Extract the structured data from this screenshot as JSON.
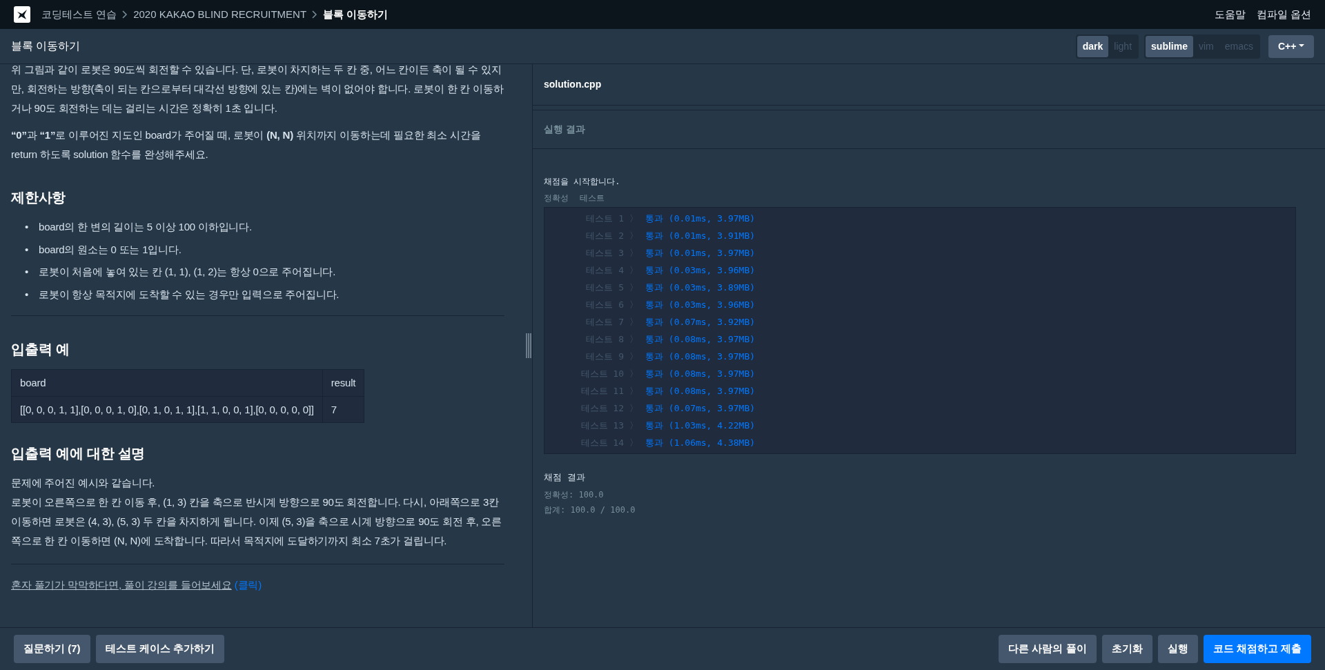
{
  "breadcrumb": [
    {
      "label": "코딩테스트 연습",
      "current": false
    },
    {
      "label": "2020 KAKAO BLIND RECRUITMENT",
      "current": false
    },
    {
      "label": "블록 이동하기",
      "current": true
    }
  ],
  "nav_links": [
    "도움말",
    "컴파일 옵션"
  ],
  "problem_title": "블록 이동하기",
  "theme_toggle": [
    {
      "label": "dark",
      "selected": true
    },
    {
      "label": "light",
      "selected": false
    }
  ],
  "keymap_toggle": [
    {
      "label": "sublime",
      "selected": true
    },
    {
      "label": "vim",
      "selected": false
    },
    {
      "label": "emacs",
      "selected": false
    }
  ],
  "language": "C++",
  "description": [
    "위 그림과 같이 로봇은 90도씩 회전할 수 있습니다. 단, 로봇이 차지하는 두 칸 중, 어느 칸이든 축이 될 수 있지만, 회전하는 방향(축이 되는 칸으로부터 대각선 방향에 있는 칸)에는 벽이 없어야 합니다. 로봇이 한 칸 이동하거나 90도 회전하는 데는 걸리는 시간은 정확히 1초 입니다.",
    "**“0”**과 **“1”**로 이루어진 지도인 board가 주어질 때, 로봇이 **(N, N)** 위치까지 이동하는데 필요한 최소 시간을 return 하도록 solution 함수를 완성해주세요."
  ],
  "constraints": {
    "title": "제한사항",
    "items": [
      {
        "marker": "•",
        "text": "board의 한 변의 길이는 5 이상 100 이하입니다."
      },
      {
        "marker": "•",
        "text": "board의 원소는 0 또는 1입니다."
      },
      {
        "marker": "•",
        "text": "로봇이 처음에 놓여 있는 칸 (1, 1), (1, 2)는 항상 0으로 주어집니다."
      },
      {
        "marker": "•",
        "text": "로봇이 항상 목적지에 도착할 수 있는 경우만 입력으로 주어집니다."
      }
    ]
  },
  "examples": {
    "title": "입출력 예",
    "columns": [
      "board",
      "result"
    ],
    "rows": [
      [
        "[[0, 0, 0, 1, 1],[0, 0, 0, 1, 0],[0, 1, 0, 1, 1],[1, 1, 0, 0, 1],[0, 0, 0, 0, 0]]",
        "7"
      ]
    ]
  },
  "explanation": {
    "title": "입출력 예에 대한 설명",
    "lines": [
      "문제에 주어진 예시와 같습니다.",
      "로봇이 오른쪽으로 한 칸 이동 후, (1, 3) 칸을 축으로 반시계 방향으로 90도 회전합니다. 다시, 아래쪽으로 3칸 이동하면 로봇은 (4, 3), (5, 3) 두 칸을 차지하게 됩니다. 이제 (5, 3)을 축으로 시계 방향으로 90도 회전 후, 오른쪽으로 한 칸 이동하면 (N, N)에 도착합니다. 따라서 목적지에 도달하기까지 최소 7초가 걸립니다."
    ]
  },
  "help_link": {
    "text": "혼자 풀기가 막막하다면, 풀이 강의를 들어보세요",
    "link": "(클릭)"
  },
  "editor_tab": "solution.cpp",
  "result_title": "실행 결과",
  "grading": {
    "start": "채점을 시작합니다.",
    "labels": [
      "정확성",
      "테스트"
    ],
    "tests": [
      {
        "label": "테스트 1",
        "arrow": "〉",
        "passed": true,
        "result": "통과 (0.01ms, 3.97MB)"
      },
      {
        "label": "테스트 2",
        "arrow": "〉",
        "passed": true,
        "result": "통과 (0.01ms, 3.91MB)"
      },
      {
        "label": "테스트 3",
        "arrow": "〉",
        "passed": true,
        "result": "통과 (0.01ms, 3.97MB)"
      },
      {
        "label": "테스트 4",
        "arrow": "〉",
        "passed": true,
        "result": "통과 (0.03ms, 3.96MB)"
      },
      {
        "label": "테스트 5",
        "arrow": "〉",
        "passed": true,
        "result": "통과 (0.03ms, 3.89MB)"
      },
      {
        "label": "테스트 6",
        "arrow": "〉",
        "passed": true,
        "result": "통과 (0.03ms, 3.96MB)"
      },
      {
        "label": "테스트 7",
        "arrow": "〉",
        "passed": true,
        "result": "통과 (0.07ms, 3.92MB)"
      },
      {
        "label": "테스트 8",
        "arrow": "〉",
        "passed": true,
        "result": "통과 (0.08ms, 3.97MB)"
      },
      {
        "label": "테스트 9",
        "arrow": "〉",
        "passed": true,
        "result": "통과 (0.08ms, 3.97MB)"
      },
      {
        "label": "테스트 10",
        "arrow": "〉",
        "passed": true,
        "result": "통과 (0.08ms, 3.97MB)"
      },
      {
        "label": "테스트 11",
        "arrow": "〉",
        "passed": true,
        "result": "통과 (0.08ms, 3.97MB)"
      },
      {
        "label": "테스트 12",
        "arrow": "〉",
        "passed": true,
        "result": "통과 (0.07ms, 3.97MB)"
      },
      {
        "label": "테스트 13",
        "arrow": "〉",
        "passed": true,
        "result": "통과 (1.03ms, 4.22MB)"
      },
      {
        "label": "테스트 14",
        "arrow": "〉",
        "passed": true,
        "result": "통과 (1.06ms, 4.38MB)"
      }
    ],
    "summary_title": "채점 결과",
    "summary": [
      "정확성: 100.0",
      "합계: 100.0 / 100.0"
    ]
  },
  "left_buttons": [
    "질문하기 (7)",
    "테스트 케이스 추가하기"
  ],
  "right_buttons": [
    {
      "label": "다른 사람의 풀이",
      "kind": "secondary"
    },
    {
      "label": "초기화",
      "kind": "secondary"
    },
    {
      "label": "실행",
      "kind": "secondary"
    },
    {
      "label": "코드 채점하고 제출",
      "kind": "primary"
    }
  ]
}
